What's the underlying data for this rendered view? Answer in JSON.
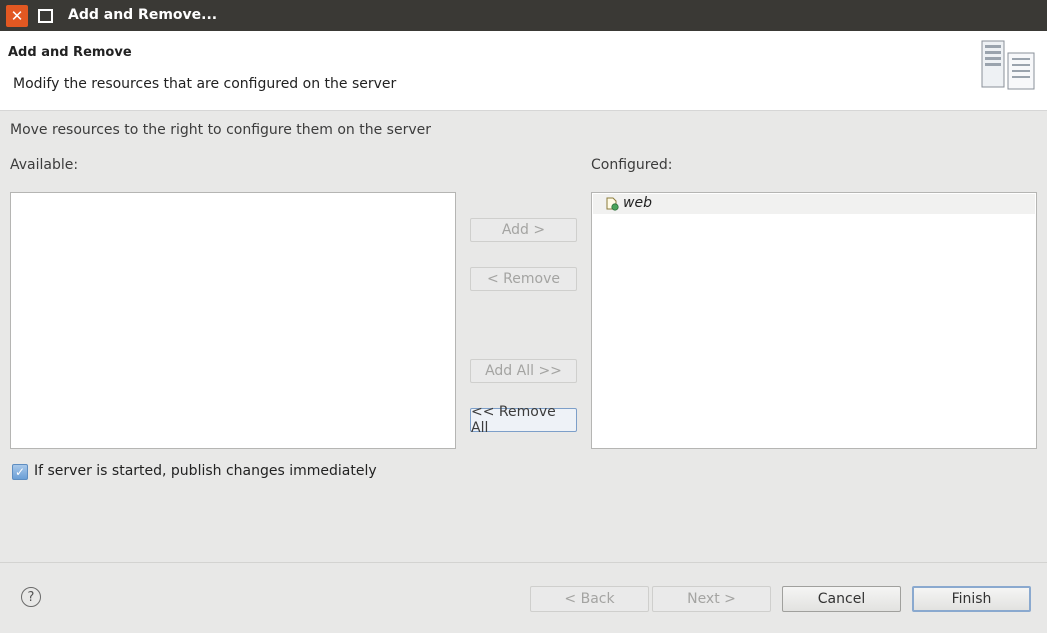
{
  "window": {
    "title": "Add and Remove..."
  },
  "banner": {
    "title": "Add and Remove",
    "description": "Modify the resources that are configured on the server",
    "icon": "server-icon"
  },
  "instruction": "Move resources to the right to configure them on the server",
  "available": {
    "label": "Available:",
    "items": []
  },
  "configured": {
    "label": "Configured:",
    "items": [
      {
        "label": "web",
        "icon": "web-module-icon"
      }
    ]
  },
  "buttons": {
    "add": "Add >",
    "remove": "< Remove",
    "add_all": "Add All >>",
    "remove_all": "<< Remove All"
  },
  "publish_checkbox": {
    "label": "If server is started, publish changes immediately",
    "checked": true
  },
  "footer": {
    "back": "< Back",
    "next": "Next >",
    "cancel": "Cancel",
    "finish": "Finish"
  }
}
